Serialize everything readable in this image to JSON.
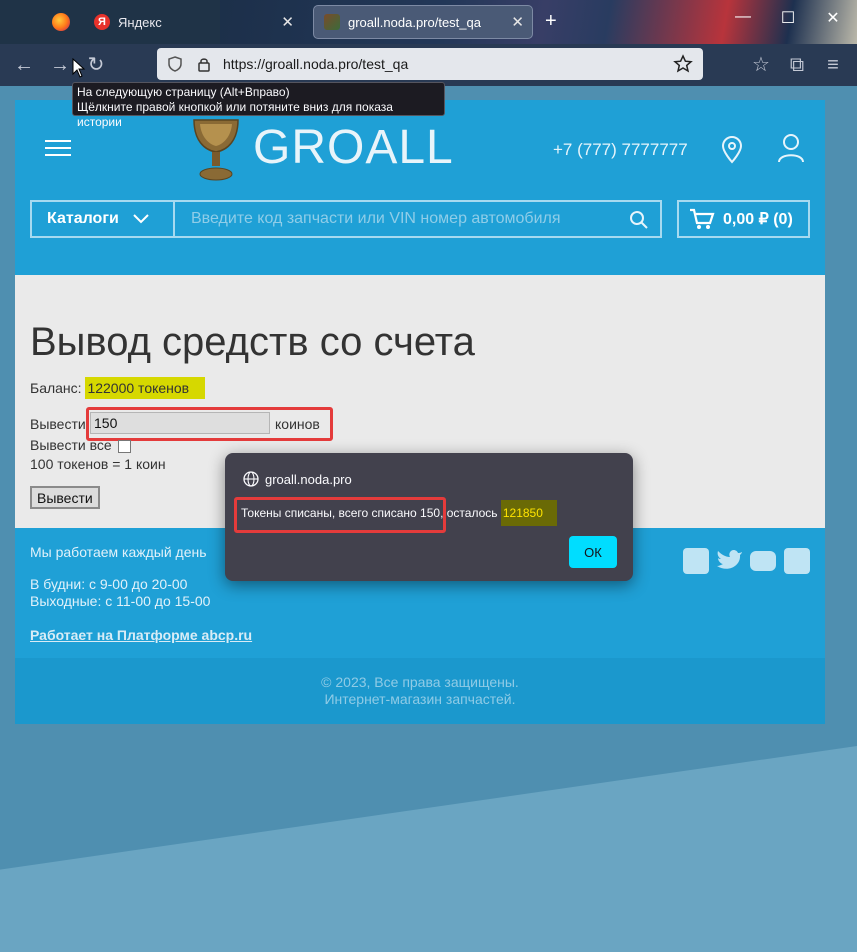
{
  "browser": {
    "tabs": [
      {
        "label": ""
      },
      {
        "label": "Яндекс"
      },
      {
        "label": "groall.noda.pro/test_qa"
      }
    ],
    "url": "https://groall.noda.pro/test_qa",
    "tooltip_line1": "На следующую страницу (Alt+Вправо)",
    "tooltip_line2": "Щёлкните правой кнопкой или потяните вниз для показа истории"
  },
  "site": {
    "logo": "GROALL",
    "phone": "+7 (777) 7777777",
    "catalog_label": "Каталоги",
    "search_placeholder": "Введите код запчасти или VIN номер автомобиля",
    "cart_label": "0,00 ₽ (0)"
  },
  "main": {
    "title": "Вывод средств со счета",
    "balance_label": "Баланс:",
    "balance_value": "122000 токенов",
    "withdraw_label": "Вывести",
    "withdraw_amount": "150",
    "coins_label": "коинов",
    "withdraw_all_label": "Вывести все",
    "rate_text": "100 токенов = 1 коин",
    "submit_label": "Вывести"
  },
  "footer": {
    "schedule_title": "Мы работаем каждый день",
    "weekdays": "В будни: с 9-00 до 20-00",
    "weekends": "Выходные: с 11-00 до 15-00",
    "platform_link": "Работает на Платформе abcp.ru",
    "copyright": "© 2023, Все права защищены.",
    "tagline": "Интернет-магазин запчастей."
  },
  "dialog": {
    "origin": "groall.noda.pro",
    "message": "Токены списаны, всего списано 150, осталось",
    "remaining": "121850",
    "ok_label": "ОК"
  },
  "colors": {
    "site_accent": "#1fa0d6",
    "highlight": "#d6d800",
    "annotation": "#e43b3b",
    "dialog_bg": "#42414d",
    "ok_button": "#00ddff"
  }
}
